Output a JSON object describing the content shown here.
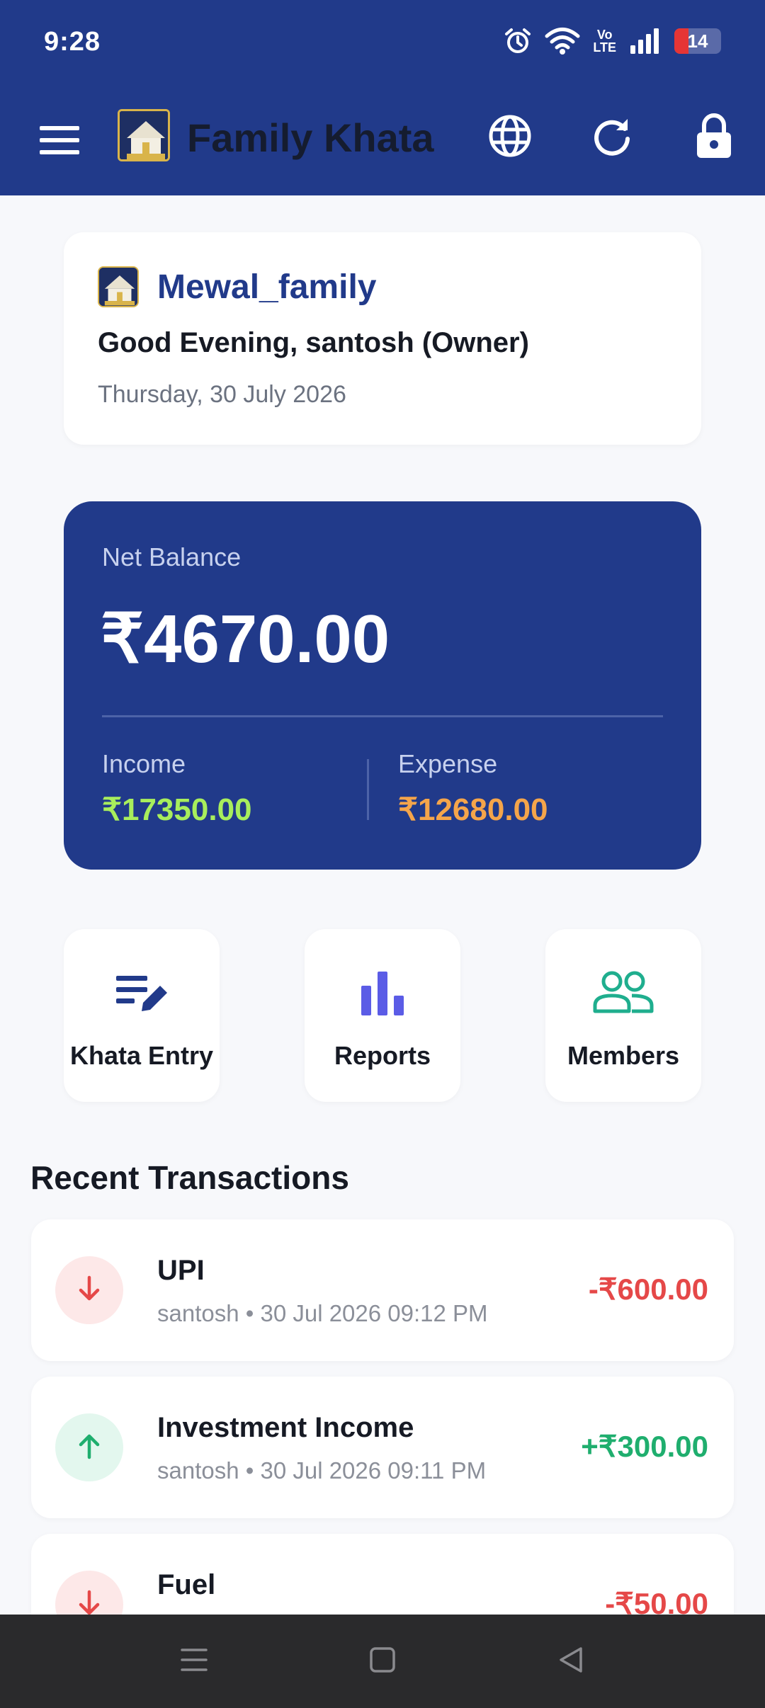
{
  "status_bar": {
    "time": "9:28",
    "volte_top": "Vo",
    "volte_bottom": "LTE",
    "battery_level": "14",
    "icons": [
      "alarm-icon",
      "wifi-icon",
      "volte-icon",
      "signal-icon",
      "battery-icon"
    ]
  },
  "app_bar": {
    "title": "Family Khata",
    "actions": [
      "globe-icon",
      "refresh-icon",
      "lock-icon"
    ]
  },
  "family_card": {
    "family_name": "Mewal_family",
    "greeting": "Good Evening, santosh (Owner)",
    "date": "Thursday, 30 July 2026"
  },
  "balance": {
    "label": "Net Balance",
    "amount": "₹4670.00",
    "income_label": "Income",
    "income_value": "₹17350.00",
    "expense_label": "Expense",
    "expense_value": "₹12680.00"
  },
  "actions": [
    {
      "label": "Khata Entry",
      "icon": "edit-list-icon"
    },
    {
      "label": "Reports",
      "icon": "bar-chart-icon"
    },
    {
      "label": "Members",
      "icon": "people-icon"
    }
  ],
  "recent": {
    "title": "Recent Transactions",
    "items": [
      {
        "title": "UPI",
        "meta": "santosh • 30 Jul 2026  09:12 PM",
        "amount": "-₹600.00",
        "direction": "out"
      },
      {
        "title": "Investment Income",
        "meta": "santosh • 30 Jul 2026  09:11 PM",
        "amount": "+₹300.00",
        "direction": "in"
      },
      {
        "title": "Fuel",
        "meta": "",
        "amount": "-₹50.00",
        "direction": "out"
      }
    ]
  },
  "colors": {
    "primary": "#213a8a",
    "income": "#a8ee5c",
    "expense": "#f5a54a",
    "negative": "#e54848",
    "positive": "#1fae6e"
  }
}
